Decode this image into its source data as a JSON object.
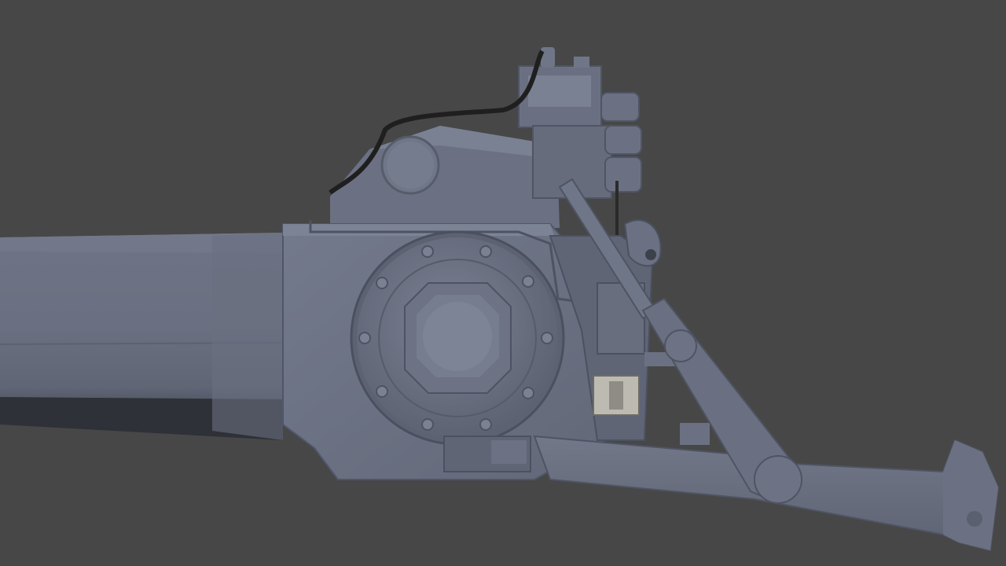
{
  "scene": {
    "subject": "tractor-three-point-hitch-render",
    "background_color": "#474747",
    "colors": {
      "metal_base": "#6c7283",
      "metal_light": "#7d8496",
      "metal_dark": "#4e5462",
      "shadow": "#2a2d33",
      "hose": "#1e1e1e",
      "connector_light": "#b9b6ad"
    }
  }
}
